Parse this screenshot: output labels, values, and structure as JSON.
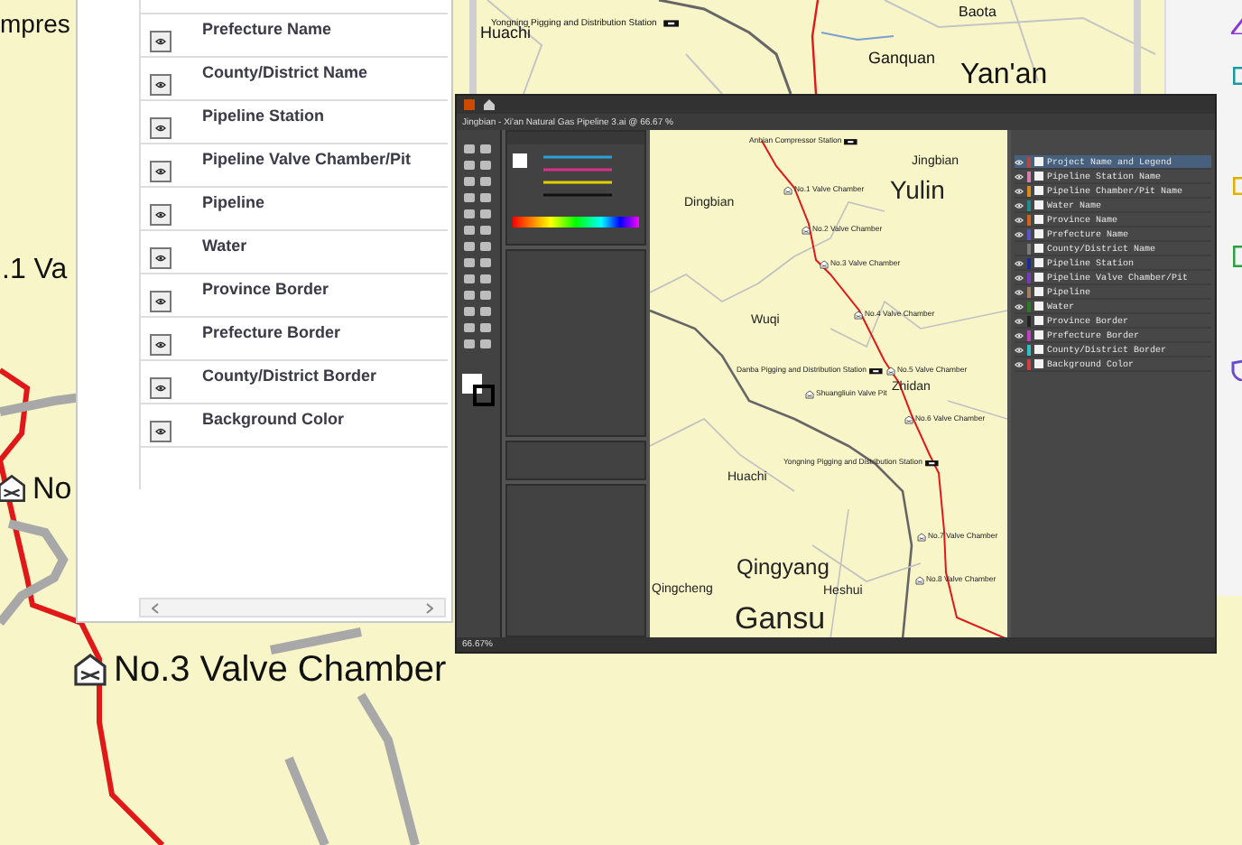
{
  "background_map": {
    "labels": [
      {
        "text": "mpres",
        "kind": "big"
      },
      {
        "text": ".1 Va",
        "kind": "big"
      },
      {
        "text": "No",
        "kind": "big-valve"
      },
      {
        "text": "No.3 Valve Chamber",
        "kind": "big-valve"
      },
      {
        "text": "Huachi",
        "kind": "county"
      },
      {
        "text": "Yongning Pigging and Distribution Station",
        "kind": "station"
      },
      {
        "text": "Baota",
        "kind": "county"
      },
      {
        "text": "Ganquan",
        "kind": "county"
      },
      {
        "text": "Yan'an",
        "kind": "city"
      }
    ]
  },
  "legend_panel": {
    "items": [
      {
        "label": "Prefecture Name",
        "visible": true
      },
      {
        "label": "County/District Name",
        "visible": true
      },
      {
        "label": "Pipeline Station",
        "visible": true
      },
      {
        "label": "Pipeline Valve Chamber/Pit",
        "visible": true
      },
      {
        "label": "Pipeline",
        "visible": true
      },
      {
        "label": "Water",
        "visible": true
      },
      {
        "label": "Province Border",
        "visible": true
      },
      {
        "label": "Prefecture Border",
        "visible": true
      },
      {
        "label": "County/District Border",
        "visible": true
      },
      {
        "label": "Background Color",
        "visible": true
      }
    ]
  },
  "illustrator": {
    "document_title": "Jingbian - Xi'an Natural Gas Pipeline 3.ai @ 66.67 %",
    "zoom": "66.67%",
    "canvas_labels": [
      {
        "text": "Anbian Compressor Station",
        "kind": "station"
      },
      {
        "text": "Jingbian",
        "kind": "county"
      },
      {
        "text": "No.1 Valve Chamber",
        "kind": "valve"
      },
      {
        "text": "Yulin",
        "kind": "city"
      },
      {
        "text": "Dingbian",
        "kind": "county"
      },
      {
        "text": "No.2 Valve Chamber",
        "kind": "valve"
      },
      {
        "text": "No.3 Valve Chamber",
        "kind": "valve"
      },
      {
        "text": "Wuqi",
        "kind": "county"
      },
      {
        "text": "No.4 Valve Chamber",
        "kind": "valve"
      },
      {
        "text": "Danba Pigging and Distribution Station",
        "kind": "station"
      },
      {
        "text": "No.5 Valve Chamber",
        "kind": "valve"
      },
      {
        "text": "Shuangliuin Valve Pit",
        "kind": "valve"
      },
      {
        "text": "Zhidan",
        "kind": "county"
      },
      {
        "text": "No.6 Valve Chamber",
        "kind": "valve"
      },
      {
        "text": "Yongning Pigging and Distribution Station",
        "kind": "station"
      },
      {
        "text": "Huachi",
        "kind": "county"
      },
      {
        "text": "No.7 Valve Chamber",
        "kind": "valve"
      },
      {
        "text": "Qingyang",
        "kind": "city"
      },
      {
        "text": "Qingcheng",
        "kind": "county"
      },
      {
        "text": "Heshui",
        "kind": "county"
      },
      {
        "text": "No.8 Valve Chamber",
        "kind": "valve"
      },
      {
        "text": "Gansu",
        "kind": "province"
      }
    ],
    "layers": [
      {
        "name": "Project Name and Legend",
        "color": "#b4473a",
        "visible": true,
        "selected": true
      },
      {
        "name": "Pipeline Station Name",
        "color": "#d97fb0",
        "visible": true,
        "selected": false
      },
      {
        "name": "Pipeline Chamber/Pit Name",
        "color": "#d98a1c",
        "visible": true,
        "selected": false
      },
      {
        "name": "Water Name",
        "color": "#1f8c8c",
        "visible": true,
        "selected": false
      },
      {
        "name": "Province Name",
        "color": "#d0641c",
        "visible": true,
        "selected": false
      },
      {
        "name": "Prefecture Name",
        "color": "#5a55c8",
        "visible": true,
        "selected": false
      },
      {
        "name": "County/District Name",
        "color": "#7a7a7a",
        "visible": false,
        "selected": false
      },
      {
        "name": "Pipeline Station",
        "color": "#1a2a9a",
        "visible": true,
        "selected": false
      },
      {
        "name": "Pipeline Valve Chamber/Pit",
        "color": "#7a3ac0",
        "visible": true,
        "selected": false
      },
      {
        "name": "Pipeline",
        "color": "#a08060",
        "visible": true,
        "selected": false
      },
      {
        "name": "Water",
        "color": "#2a7a2a",
        "visible": true,
        "selected": false
      },
      {
        "name": "Province Border",
        "color": "#222222",
        "visible": true,
        "selected": false
      },
      {
        "name": "Prefecture Border",
        "color": "#c040c0",
        "visible": true,
        "selected": false
      },
      {
        "name": "County/District Border",
        "color": "#30c0c8",
        "visible": true,
        "selected": false
      },
      {
        "name": "Background Color",
        "color": "#d04040",
        "visible": true,
        "selected": false
      }
    ]
  }
}
